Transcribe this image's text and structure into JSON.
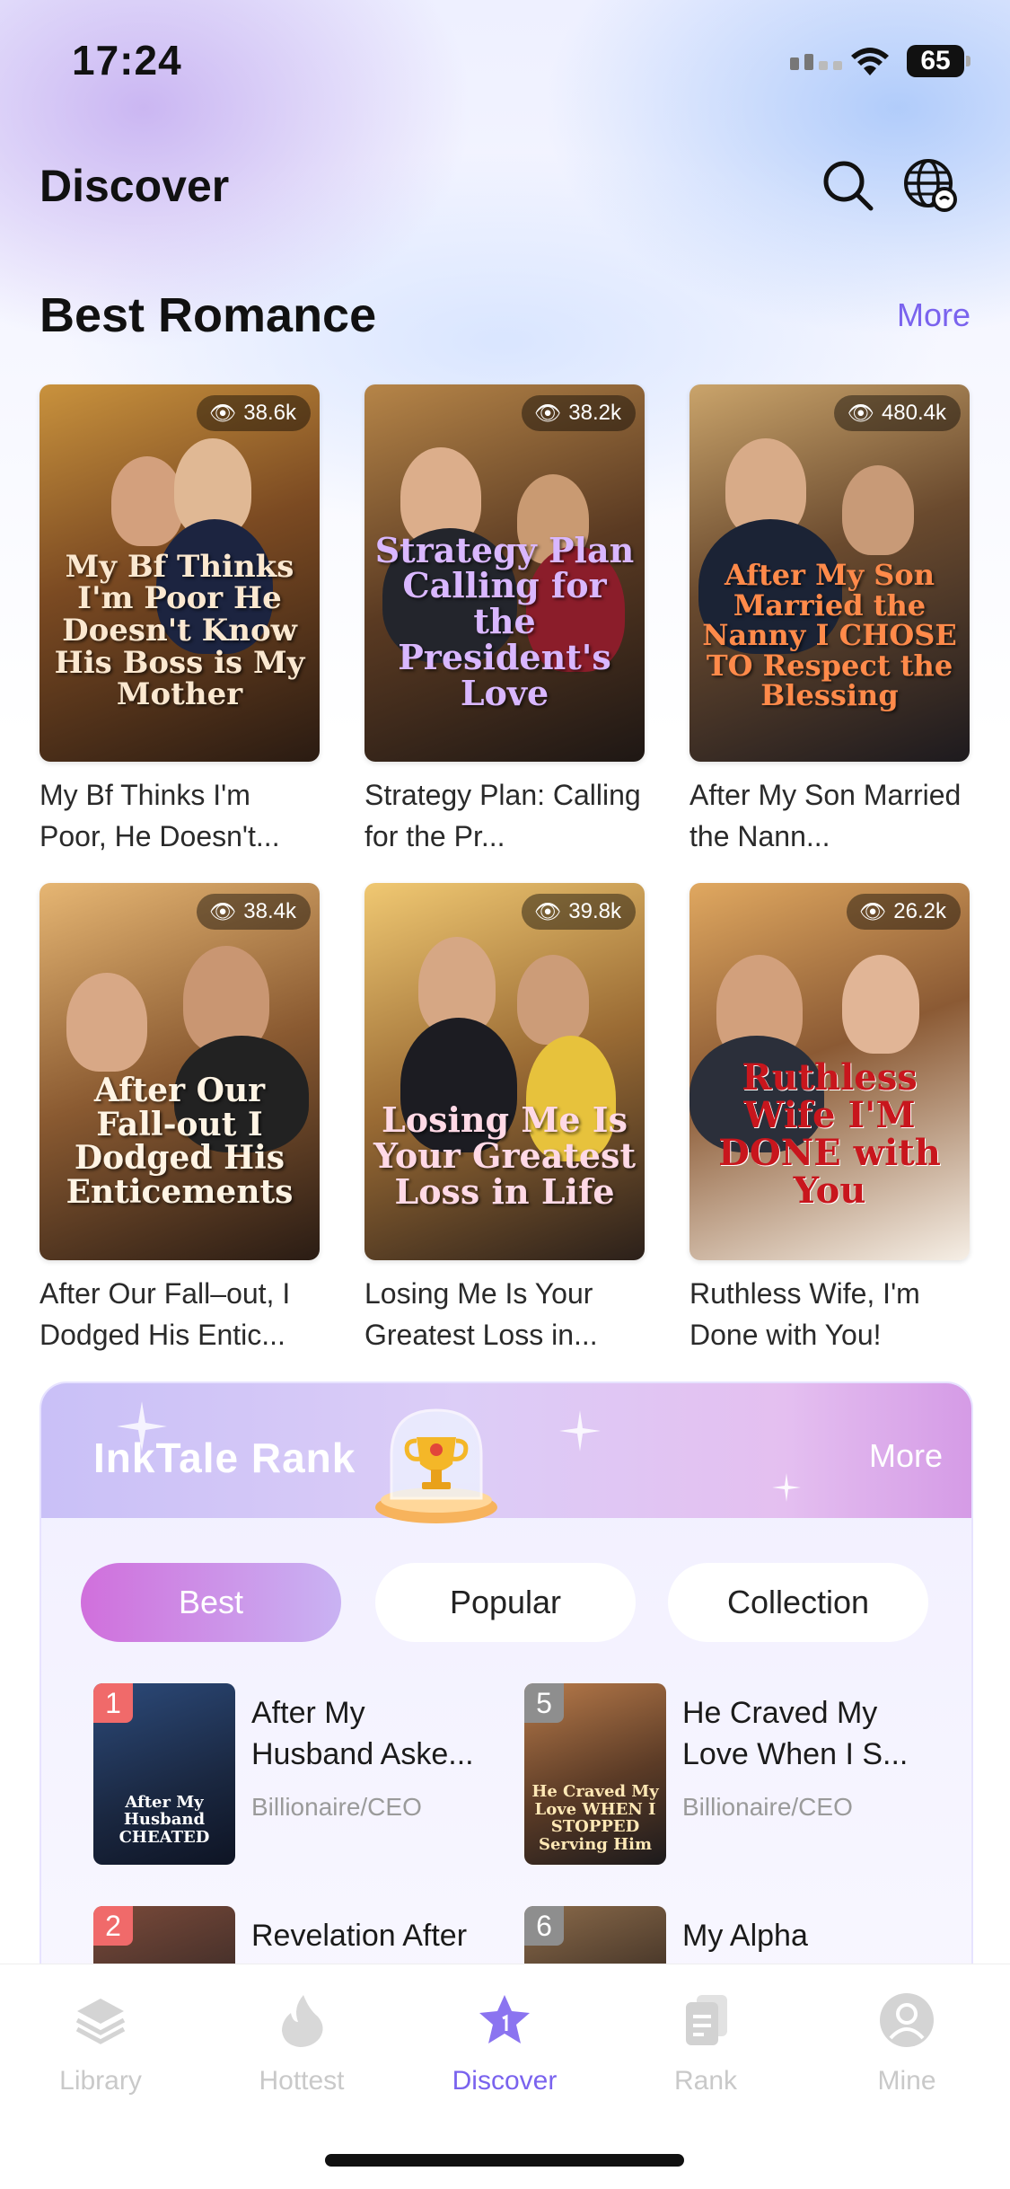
{
  "status": {
    "time": "17:24",
    "battery": "65"
  },
  "header": {
    "title": "Discover"
  },
  "section": {
    "title": "Best Romance",
    "more": "More"
  },
  "books": [
    {
      "views": "38.6k",
      "cover_text": "My Bf Thinks I'm Poor He Doesn't Know His Boss is My Mother",
      "title": "My Bf Thinks I'm Poor, He Doesn't..."
    },
    {
      "views": "38.2k",
      "cover_text": "Strategy Plan Calling for the President's Love",
      "title": "Strategy Plan: Calling for the Pr..."
    },
    {
      "views": "480.4k",
      "cover_text": "After My Son Married the Nanny I CHOSE TO Respect the Blessing",
      "title": "After My Son Married the Nann..."
    },
    {
      "views": "38.4k",
      "cover_text": "After Our Fall-out I Dodged His Enticements",
      "title": "After Our Fall–out, I Dodged His Entic..."
    },
    {
      "views": "39.8k",
      "cover_text": "Losing Me Is Your Greatest Loss in Life",
      "title": "Losing Me Is Your Greatest Loss in..."
    },
    {
      "views": "26.2k",
      "cover_text": "Ruthless Wife I'M DONE with You",
      "title": "Ruthless Wife, I'm Done with You!"
    }
  ],
  "rank": {
    "title": "InkTale Rank",
    "more": "More",
    "tabs": [
      "Best",
      "Popular",
      "Collection"
    ],
    "items": [
      {
        "rank": "1",
        "title": "After My Husband Aske...",
        "genre": "Billionaire/CEO",
        "cover_text": "After My Husband CHEATED"
      },
      {
        "rank": "5",
        "title": "He Craved My Love When I S...",
        "genre": "Billionaire/CEO",
        "cover_text": "He Craved My Love WHEN I STOPPED Serving Him"
      },
      {
        "rank": "2",
        "title": "Revelation After",
        "genre": "",
        "cover_text": ""
      },
      {
        "rank": "6",
        "title": "My Alpha",
        "genre": "",
        "cover_text": ""
      }
    ]
  },
  "tabbar": [
    {
      "label": "Library",
      "icon": "layers-icon"
    },
    {
      "label": "Hottest",
      "icon": "flame-icon"
    },
    {
      "label": "Discover",
      "icon": "star-icon"
    },
    {
      "label": "Rank",
      "icon": "document-icon"
    },
    {
      "label": "Mine",
      "icon": "profile-icon"
    }
  ],
  "colors": {
    "accent": "#7a63ee",
    "rank_active": "#d06fdc"
  }
}
